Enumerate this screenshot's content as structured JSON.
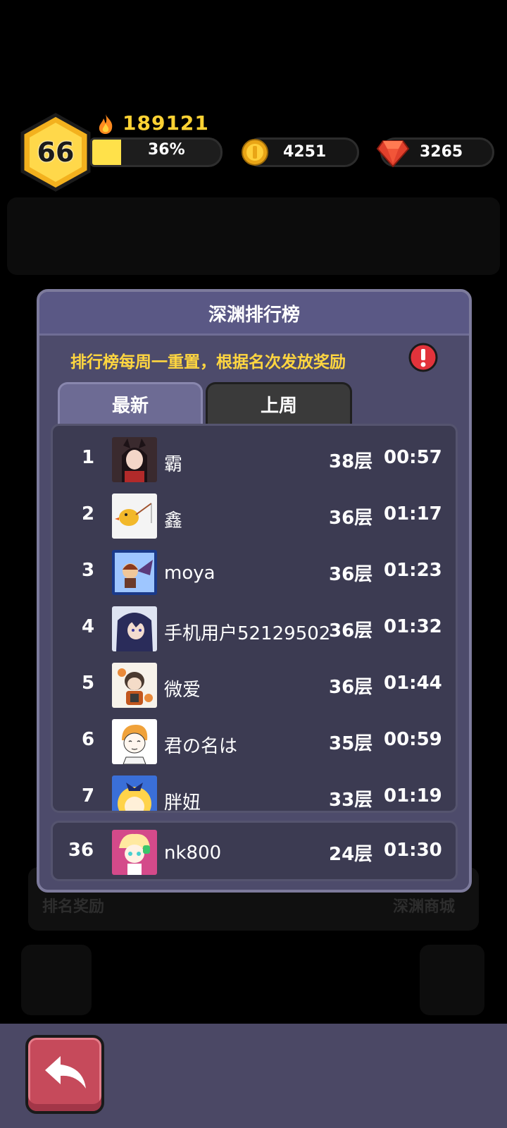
{
  "hud": {
    "level": "66",
    "power": "189121",
    "xp_percent_label": "36%",
    "xp_fraction": 0.36,
    "coins": "4251",
    "gems": "3265"
  },
  "background": {
    "left_label": "排名奖励",
    "right_label": "深渊商城"
  },
  "modal": {
    "title": "深渊排行榜",
    "notice": "排行榜每周一重置，根据名次发放奖励",
    "tabs": [
      {
        "label": "最新",
        "active": true
      },
      {
        "label": "上周",
        "active": false
      }
    ],
    "rows": [
      {
        "rank": "1",
        "name": "霸",
        "floor": "38层",
        "time": "00:57",
        "avatar_icon": "anime-girl-avatar-icon"
      },
      {
        "rank": "2",
        "name": "鑫",
        "floor": "36层",
        "time": "01:17",
        "avatar_icon": "duck-fishing-avatar-icon"
      },
      {
        "rank": "3",
        "name": "moya",
        "floor": "36层",
        "time": "01:23",
        "avatar_icon": "winged-character-avatar-icon"
      },
      {
        "rank": "4",
        "name": "手机用户52129502",
        "floor": "36层",
        "time": "01:32",
        "avatar_icon": "dark-hair-character-avatar-icon"
      },
      {
        "rank": "5",
        "name": "微爱",
        "floor": "36层",
        "time": "01:44",
        "avatar_icon": "chibi-warrior-avatar-icon"
      },
      {
        "rank": "6",
        "name": "君の名は",
        "floor": "35层",
        "time": "00:59",
        "avatar_icon": "sketch-boy-avatar-icon"
      },
      {
        "rank": "7",
        "name": "胖妞",
        "floor": "33层",
        "time": "01:19",
        "avatar_icon": "blonde-girl-avatar-icon"
      }
    ],
    "self_row": {
      "rank": "36",
      "name": "nk800",
      "floor": "24层",
      "time": "01:30",
      "avatar_icon": "pink-character-avatar-icon"
    }
  },
  "colors": {
    "gold": "#ffd640",
    "modal_bg": "#4d4b6b",
    "back_button": "#c64a5b"
  }
}
